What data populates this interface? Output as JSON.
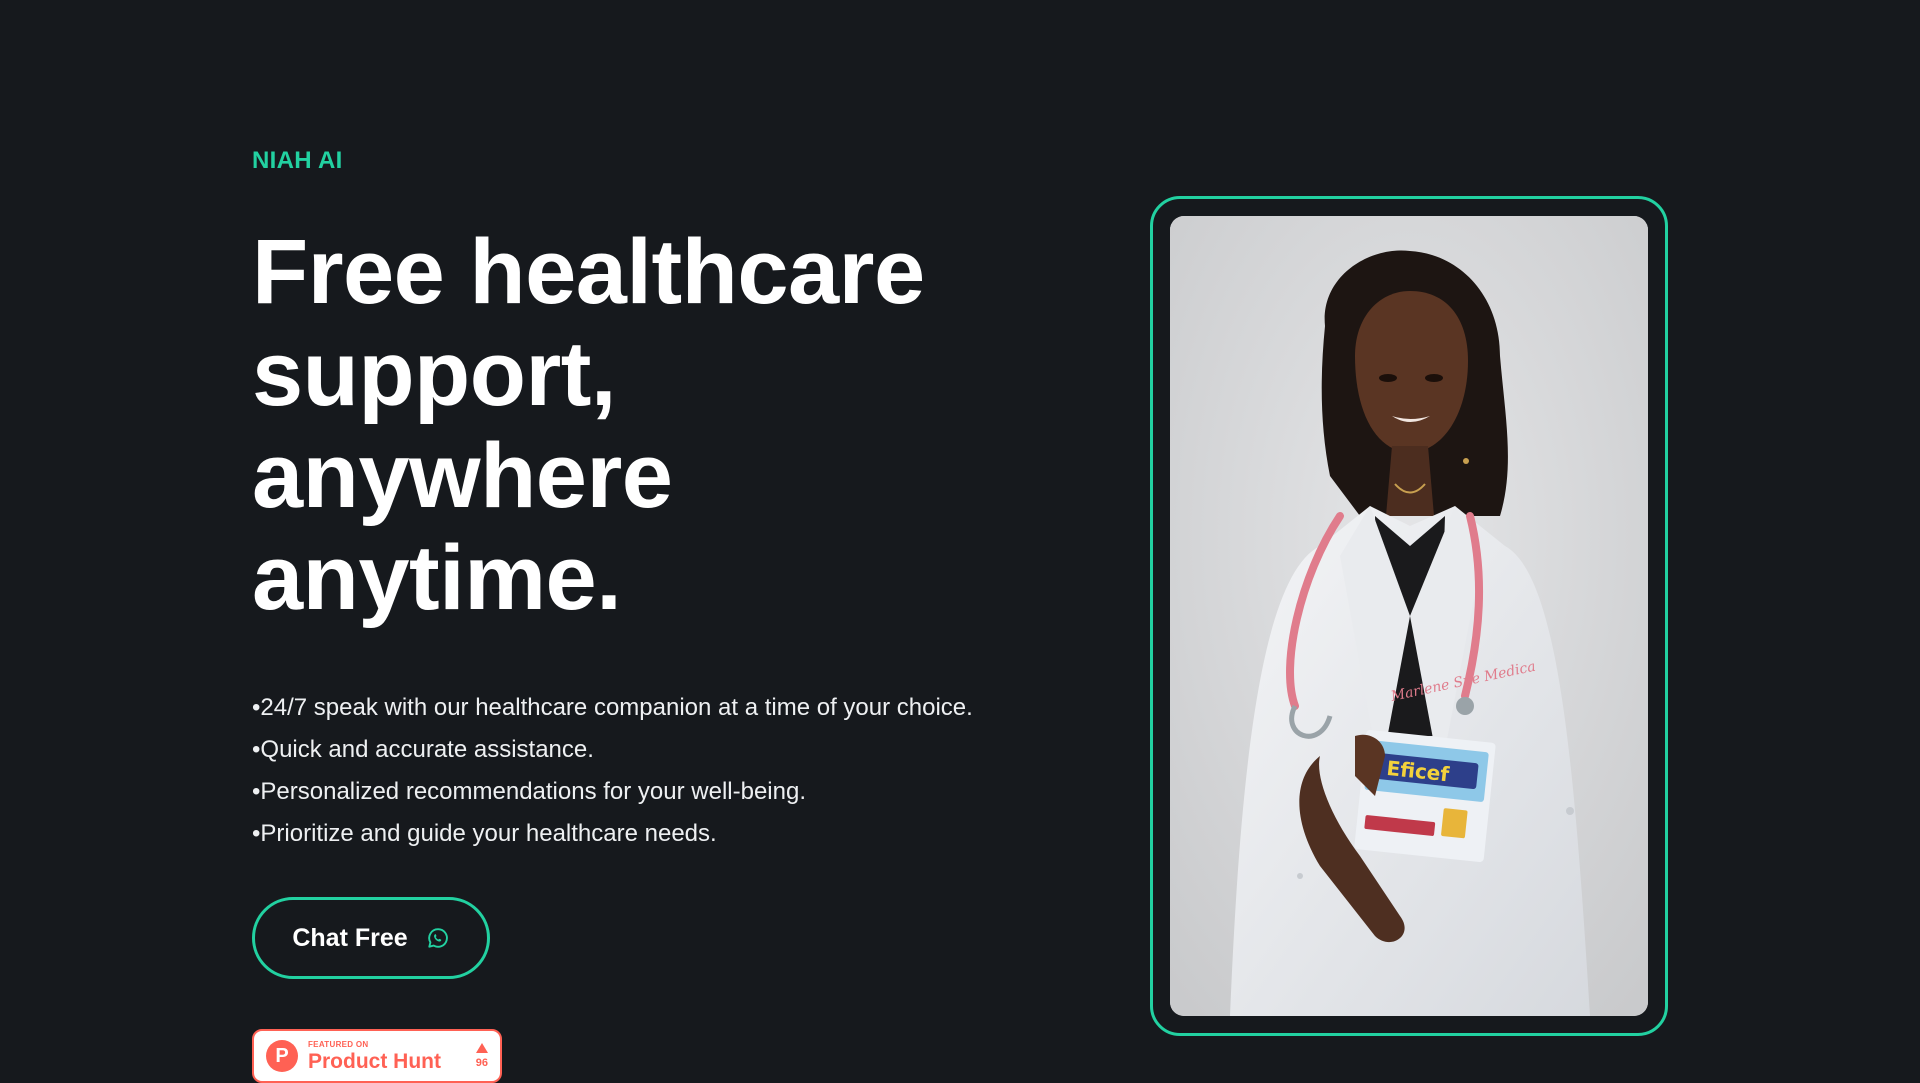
{
  "brand": {
    "eyebrow": "NIAH AI",
    "accent_color": "#22d1a1",
    "background_color": "#16191d"
  },
  "hero": {
    "headline_lines": [
      "Free healthcare",
      "support,",
      "anywhere",
      "anytime."
    ],
    "features": [
      "•24/7 speak with our healthcare companion at a time of your choice.",
      "•Quick and accurate assistance.",
      "•Personalized recommendations for your well-being.",
      "•Prioritize and guide your healthcare needs."
    ]
  },
  "cta": {
    "label": "Chat Free",
    "icon": "whatsapp-icon"
  },
  "product_hunt": {
    "small_label": "FEATURED ON",
    "name": "Product Hunt",
    "votes": "96",
    "logo_letter": "P",
    "color": "#ff6154"
  },
  "photo": {
    "subject": "doctor-photo",
    "book_label": "Eficef",
    "coat_embroidery": "Marlene Sue Medica"
  }
}
